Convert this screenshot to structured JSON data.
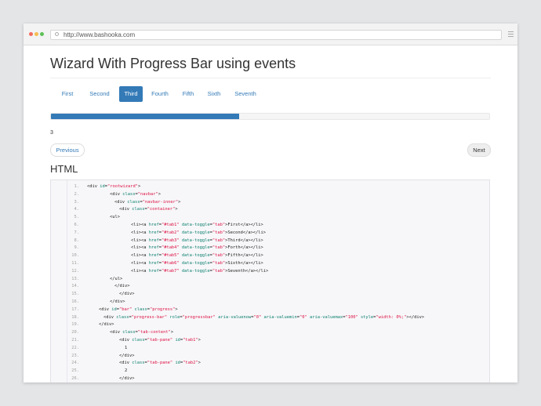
{
  "browser": {
    "url": "http://www.bashooka.com"
  },
  "page": {
    "title": "Wizard With Progress Bar using events",
    "tabs": [
      "First",
      "Second",
      "Third",
      "Fourth",
      "Fifth",
      "Sixth",
      "Seventh"
    ],
    "active_tab_index": 2,
    "progress_percent": 43,
    "step_number": "3",
    "previous_label": "Previous",
    "next_label": "Next",
    "code_heading": "HTML"
  },
  "colors": {
    "accent": "#337ab7",
    "page_background": "#e4e5e7",
    "code_attr_name": "#0a7f6e",
    "code_attr_value": "#d14"
  },
  "code_lines": [
    {
      "n": "1.",
      "t": "<div id=\"rootwizard\">",
      "i": 0
    },
    {
      "n": "2.",
      "t": "<div class=\"navbar\">",
      "i": 1
    },
    {
      "n": "3.",
      "t": "<div class=\"navbar-inner\">",
      "i": 2
    },
    {
      "n": "4.",
      "t": "<div class=\"container\">",
      "i": 3
    },
    {
      "n": "5.",
      "t": "<ul>",
      "i": 1
    },
    {
      "n": "6.",
      "t": "<li><a href=\"#tab1\" data-toggle=\"tab\">First</a></li>",
      "i": 4
    },
    {
      "n": "7.",
      "t": "<li><a href=\"#tab2\" data-toggle=\"tab\">Second</a></li>",
      "i": 4
    },
    {
      "n": "8.",
      "t": "<li><a href=\"#tab3\" data-toggle=\"tab\">Third</a></li>",
      "i": 4
    },
    {
      "n": "9.",
      "t": "<li><a href=\"#tab4\" data-toggle=\"tab\">Forth</a></li>",
      "i": 4
    },
    {
      "n": "10.",
      "t": "<li><a href=\"#tab5\" data-toggle=\"tab\">Fifth</a></li>",
      "i": 4
    },
    {
      "n": "11.",
      "t": "<li><a href=\"#tab6\" data-toggle=\"tab\">Sixth</a></li>",
      "i": 4
    },
    {
      "n": "12.",
      "t": "<li><a href=\"#tab7\" data-toggle=\"tab\">Seventh</a></li>",
      "i": 4
    },
    {
      "n": "13.",
      "t": "</ul>",
      "i": 1
    },
    {
      "n": "14.",
      "t": "</div>",
      "i": 2
    },
    {
      "n": "15.",
      "t": "</div>",
      "i": 3
    },
    {
      "n": "16.",
      "t": "</div>",
      "i": 1
    },
    {
      "n": "17.",
      "t": "<div id=\"bar\" class=\"progress\">",
      "i": 5
    },
    {
      "n": "18.",
      "t": "<div class=\"progress-bar\" role=\"progressbar\" aria-valuenow=\"0\" aria-valuemin=\"0\" aria-valuemax=\"100\" style=\"width: 0%;\"></div>",
      "i": 6
    },
    {
      "n": "19.",
      "t": "</div>",
      "i": 5
    },
    {
      "n": "20.",
      "t": "<div class=\"tab-content\">",
      "i": 1
    },
    {
      "n": "21.",
      "t": "<div class=\"tab-pane\" id=\"tab1\">",
      "i": 7
    },
    {
      "n": "22.",
      "t": "1",
      "i": 8
    },
    {
      "n": "23.",
      "t": "</div>",
      "i": 7
    },
    {
      "n": "24.",
      "t": "<div class=\"tab-pane\" id=\"tab2\">",
      "i": 7
    },
    {
      "n": "25.",
      "t": "2",
      "i": 8
    },
    {
      "n": "26.",
      "t": "</div>",
      "i": 7
    }
  ]
}
